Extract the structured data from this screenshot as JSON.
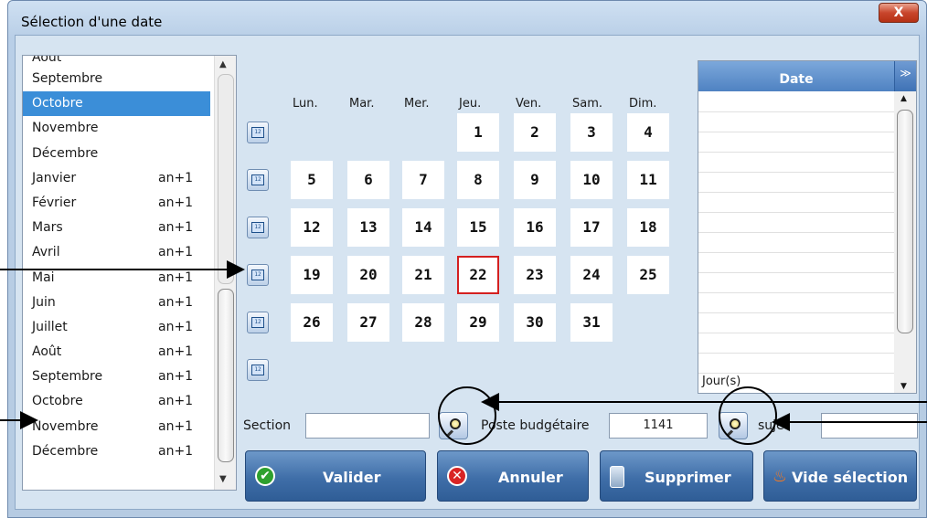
{
  "window": {
    "title": "Sélection d'une date",
    "close_glyph": "X"
  },
  "month_list": {
    "rows": [
      {
        "label": "Août",
        "suffix": ""
      },
      {
        "label": "Septembre",
        "suffix": ""
      },
      {
        "label": "Octobre",
        "suffix": "",
        "selected": true
      },
      {
        "label": "Novembre",
        "suffix": ""
      },
      {
        "label": "Décembre",
        "suffix": ""
      },
      {
        "label": "Janvier",
        "suffix": "an+1"
      },
      {
        "label": "Février",
        "suffix": "an+1"
      },
      {
        "label": "Mars",
        "suffix": "an+1"
      },
      {
        "label": "Avril",
        "suffix": "an+1"
      },
      {
        "label": "Mai",
        "suffix": "an+1"
      },
      {
        "label": "Juin",
        "suffix": "an+1"
      },
      {
        "label": "Juillet",
        "suffix": "an+1"
      },
      {
        "label": "Août",
        "suffix": "an+1"
      },
      {
        "label": "Septembre",
        "suffix": "an+1"
      },
      {
        "label": "Octobre",
        "suffix": "an+1"
      },
      {
        "label": "Novembre",
        "suffix": "an+1"
      },
      {
        "label": "Décembre",
        "suffix": "an+1"
      }
    ]
  },
  "calendar": {
    "weekdays": [
      "Lun.",
      "Mar.",
      "Mer.",
      "Jeu.",
      "Ven.",
      "Sam.",
      "Dim."
    ],
    "weeks": [
      [
        "",
        "",
        "",
        "1",
        "2",
        "3",
        "4"
      ],
      [
        "5",
        "6",
        "7",
        "8",
        "9",
        "10",
        "11"
      ],
      [
        "12",
        "13",
        "14",
        "15",
        "16",
        "17",
        "18"
      ],
      [
        "19",
        "20",
        "21",
        "22",
        "23",
        "24",
        "25"
      ],
      [
        "26",
        "27",
        "28",
        "29",
        "30",
        "31",
        ""
      ],
      [
        "",
        "",
        "",
        "",
        "",
        "",
        ""
      ]
    ],
    "today": "22",
    "week_icon_glyph": "12"
  },
  "date_panel": {
    "header": "Date",
    "menu_glyph": "≫",
    "footer": "Jour(s)"
  },
  "fields": {
    "section_label": "Section",
    "section_value": "",
    "poste_label": "Poste budgétaire",
    "poste_value": "1141",
    "sujet_label": "sujet",
    "sujet_value": ""
  },
  "actions": {
    "valider": "Valider",
    "annuler": "Annuler",
    "supprimer": "Supprimer",
    "vide": "Vide sélection"
  },
  "colors": {
    "selected_row": "#3b8ed8",
    "today_border": "#d42020",
    "button_blue": "#3f6ea8"
  }
}
